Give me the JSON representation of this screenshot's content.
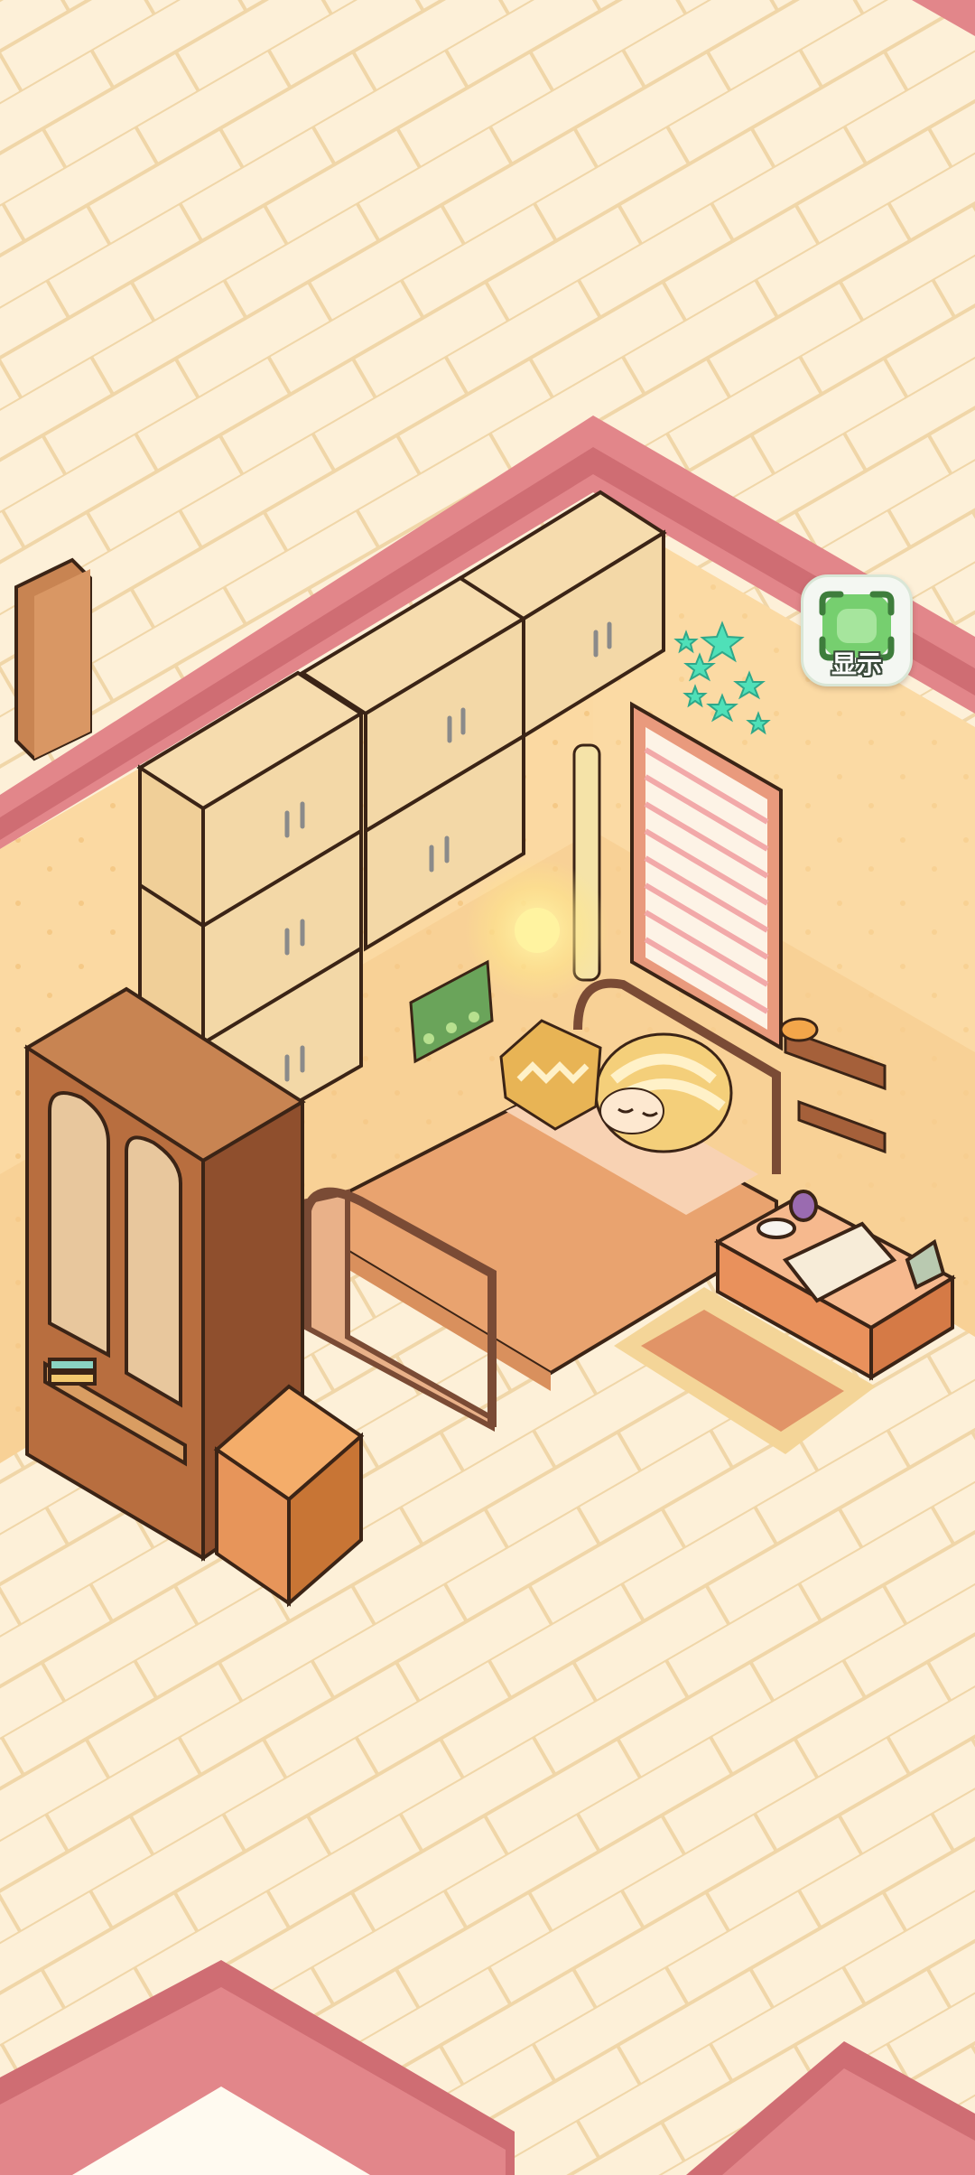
{
  "scene": {
    "name": "bedroom",
    "furniture": [
      "wall-cabinets",
      "wardrobe",
      "nightstand-drawer",
      "bed",
      "window-blinds",
      "wall-shelves",
      "bedside-table",
      "rug",
      "floor-lamp",
      "star-stickers",
      "door"
    ],
    "character_state": "sleeping"
  },
  "show_button": {
    "label": "显示",
    "icon": "expand-frame-icon"
  },
  "colors": {
    "floor": "#fdf0d8",
    "floor_lines": "#f0d6a8",
    "wall": "#fbd9a2",
    "wall_trim": "#e28a8c",
    "wood_dark": "#a5603a",
    "bedsheet": "#e9a36f",
    "stars": "#4fe0b8",
    "button_green": "#76cf6f"
  }
}
